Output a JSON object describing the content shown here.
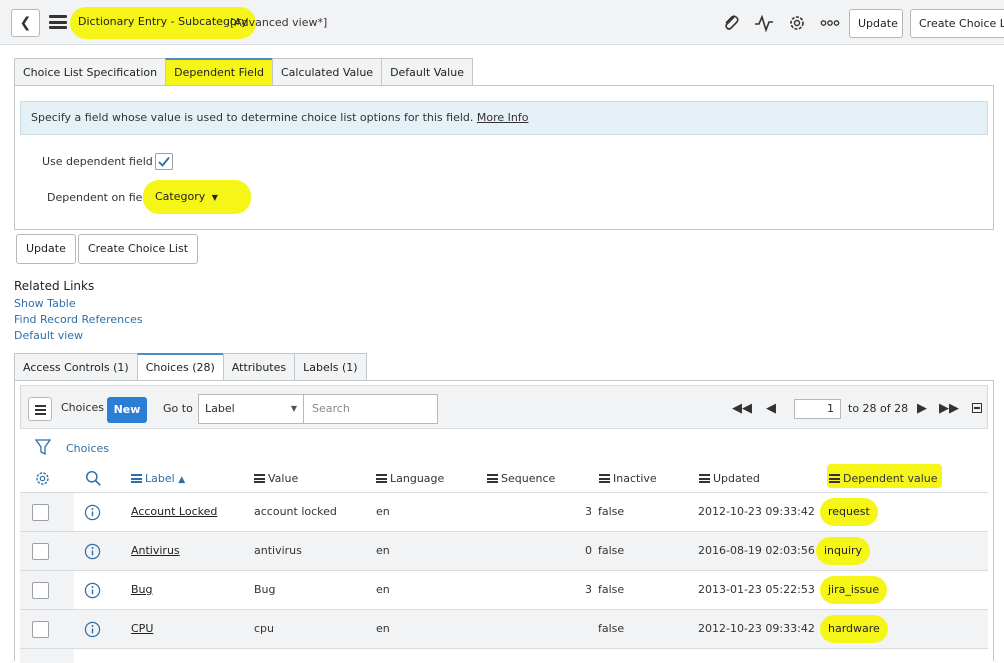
{
  "header": {
    "title": "Dictionary Entry - Subcategory",
    "view_label": "[Advanced view*]",
    "update_label": "Update",
    "create_choice_list_label": "Create Choice List",
    "icons": [
      "back-icon",
      "menu-icon",
      "paperclip-icon",
      "activity-icon",
      "gear-icon",
      "more-icon"
    ]
  },
  "form_tabs": [
    "Choice List Specification",
    "Dependent Field",
    "Calculated Value",
    "Default Value"
  ],
  "dependent_field": {
    "info_text": "Specify a field whose value is used to determine choice list options for this field.",
    "more_info_label": "More Info",
    "use_dependent_label": "Use dependent field",
    "use_dependent_checked": true,
    "dependent_on_label": "Dependent on field",
    "dependent_on_value": "Category"
  },
  "form_buttons": {
    "update": "Update",
    "create_choice_list": "Create Choice List"
  },
  "related_links": {
    "title": "Related Links",
    "links": [
      "Show Table",
      "Find Record References",
      "Default view"
    ]
  },
  "related_tabs": [
    "Access Controls (1)",
    "Choices (28)",
    "Attributes",
    "Labels (1)"
  ],
  "list": {
    "title": "Choices",
    "new_label": "New",
    "goto_label": "Go to",
    "goto_field": "Label",
    "search_placeholder": "Search",
    "page": "1",
    "page_info": "to 28 of 28",
    "breadcrumb": "Choices",
    "sort_arrow": "▲",
    "columns": [
      "Label",
      "Value",
      "Language",
      "Sequence",
      "Inactive",
      "Updated",
      "Dependent value"
    ],
    "rows": [
      {
        "label": "Account Locked",
        "value": "account locked",
        "language": "en",
        "sequence": "3",
        "inactive": "false",
        "updated": "2012-10-23 09:33:42",
        "dependent_value": "request"
      },
      {
        "label": "Antivirus",
        "value": "antivirus",
        "language": "en",
        "sequence": "0",
        "inactive": "false",
        "updated": "2016-08-19 02:03:56",
        "dependent_value": "inquiry"
      },
      {
        "label": "Bug",
        "value": "Bug",
        "language": "en",
        "sequence": "3",
        "inactive": "false",
        "updated": "2013-01-23 05:22:53",
        "dependent_value": "jira_issue"
      },
      {
        "label": "CPU",
        "value": "cpu",
        "language": "en",
        "sequence": "",
        "inactive": "false",
        "updated": "2012-10-23 09:33:42",
        "dependent_value": "hardware"
      }
    ]
  },
  "colors": {
    "highlight": "#f5f518",
    "link": "#2f6fa7",
    "primary": "#2a7fd4",
    "header_bg": "#f2f3f4"
  }
}
